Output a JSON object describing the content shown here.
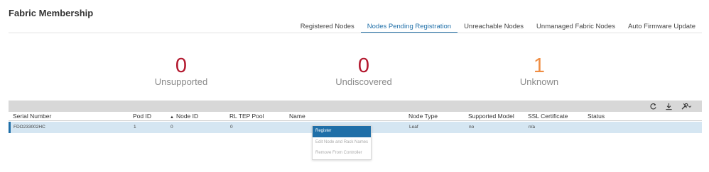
{
  "page": {
    "title": "Fabric Membership"
  },
  "tabs": [
    {
      "label": "Registered Nodes",
      "active": false
    },
    {
      "label": "Nodes Pending Registration",
      "active": true
    },
    {
      "label": "Unreachable Nodes",
      "active": false
    },
    {
      "label": "Unmanaged Fabric Nodes",
      "active": false
    },
    {
      "label": "Auto Firmware Update",
      "active": false
    }
  ],
  "stats": {
    "unsupported": {
      "value": "0",
      "label": "Unsupported",
      "color": "#b3182e"
    },
    "undiscovered": {
      "value": "0",
      "label": "Undiscovered",
      "color": "#b3182e"
    },
    "unknown": {
      "value": "1",
      "label": "Unknown",
      "color": "#ef8d43"
    }
  },
  "toolbar": {
    "icons": [
      "refresh-icon",
      "download-icon",
      "tools-icon"
    ]
  },
  "table": {
    "columns": [
      "Serial Number",
      "Pod ID",
      "Node ID",
      "RL TEP Pool",
      "Name",
      "Node Type",
      "Supported Model",
      "SSL Certificate",
      "Status"
    ],
    "sorted_column": "Node ID",
    "rows": [
      {
        "serial_number": "FDO233002HC",
        "pod_id": "1",
        "node_id": "0",
        "rl_tep_pool": "0",
        "name": "",
        "node_type": "Leaf",
        "supported_model": "no",
        "ssl_certificate": "n/a",
        "status": ""
      }
    ]
  },
  "context_menu": {
    "items": [
      {
        "label": "Register",
        "active": true
      },
      {
        "label": "Edit Node and Rack Names",
        "active": false
      },
      {
        "label": "Remove From Controller",
        "active": false
      }
    ]
  },
  "colors": {
    "accent": "#1f6fa8",
    "row_selected": "#d5e6f2",
    "toolbar_bg": "#d8d8d8"
  }
}
